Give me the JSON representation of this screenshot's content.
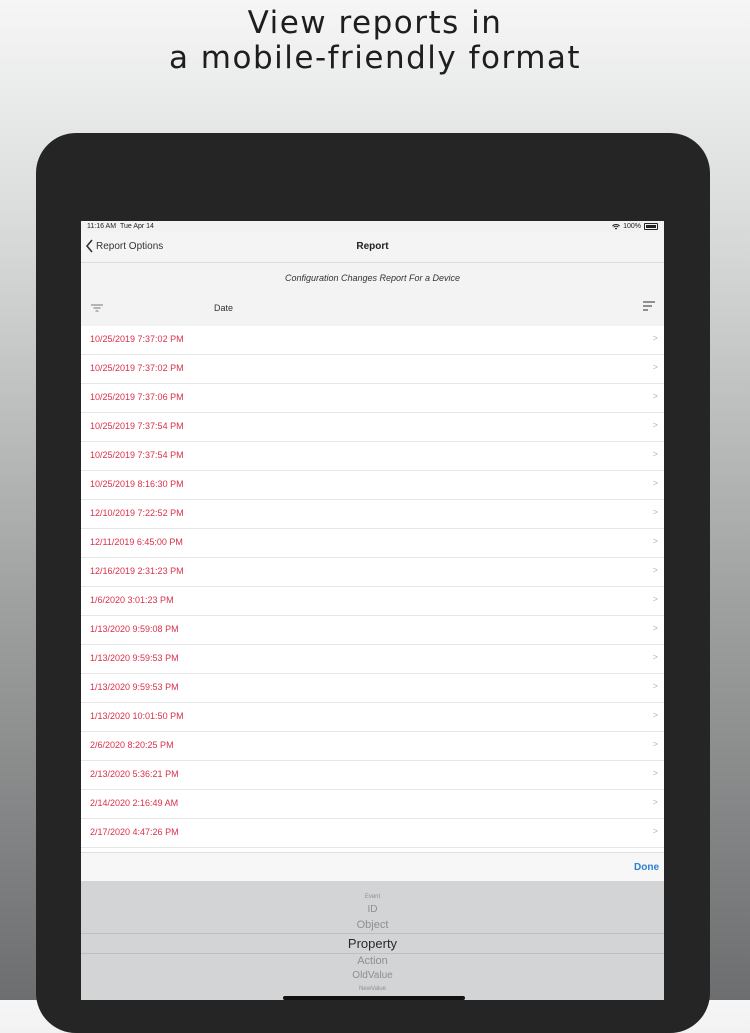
{
  "headline": {
    "line1": "View reports in",
    "line2": "a mobile-friendly format"
  },
  "status_bar": {
    "time": "11:16 AM",
    "date": "Tue Apr 14",
    "battery": "100%"
  },
  "nav": {
    "back_label": "Report Options",
    "title": "Report"
  },
  "report": {
    "subtitle": "Configuration Changes Report For a Device",
    "column_header": "Date",
    "filter_icon": "filter-icon",
    "sort_icon": "sort-icon",
    "rows": [
      "10/25/2019 7:37:02 PM",
      "10/25/2019 7:37:02 PM",
      "10/25/2019 7:37:06 PM",
      "10/25/2019 7:37:54 PM",
      "10/25/2019 7:37:54 PM",
      "10/25/2019 8:16:30 PM",
      "12/10/2019 7:22:52 PM",
      "12/11/2019 6:45:00 PM",
      "12/16/2019 2:31:23 PM",
      "1/6/2020 3:01:23 PM",
      "1/13/2020 9:59:08 PM",
      "1/13/2020 9:59:53 PM",
      "1/13/2020 9:59:53 PM",
      "1/13/2020 10:01:50 PM",
      "2/6/2020 8:20:25 PM",
      "2/13/2020 5:36:21 PM",
      "2/14/2020 2:16:49 AM",
      "2/17/2020 4:47:26 PM"
    ],
    "row_chevron": ">"
  },
  "picker": {
    "done_label": "Done",
    "options": [
      "Event",
      "ID",
      "Object",
      "Property",
      "Action",
      "OldValue",
      "NewValue"
    ],
    "selected": "Property"
  },
  "colors": {
    "date_text": "#d9304a",
    "done_button": "#2e7fd1",
    "device_frame": "#252526"
  }
}
